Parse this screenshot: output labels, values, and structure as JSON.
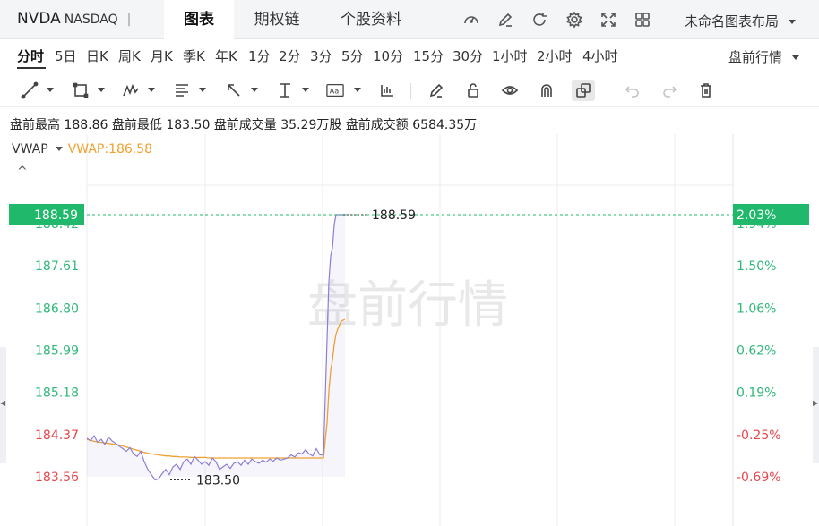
{
  "header": {
    "ticker": "NVDA",
    "exchange": "NASDAQ",
    "separator": "|",
    "tabs": [
      {
        "label": "图表",
        "active": true
      },
      {
        "label": "期权链",
        "active": false
      },
      {
        "label": "个股资料",
        "active": false
      }
    ],
    "icons": [
      "gauge-icon",
      "edit-icon",
      "refresh-icon",
      "gear-icon",
      "fullscreen-icon",
      "grid-icon"
    ],
    "layout_name": "未命名图表布局"
  },
  "periods": {
    "items": [
      "分时",
      "5日",
      "日K",
      "周K",
      "月K",
      "季K",
      "年K",
      "1分",
      "2分",
      "3分",
      "5分",
      "10分",
      "15分",
      "30分",
      "1小时",
      "2小时",
      "4小时"
    ],
    "active": "分时",
    "session": "盘前行情"
  },
  "toolbar": {
    "tools": [
      "line-tool-icon",
      "rect-tool-icon",
      "wave-tool-icon",
      "fib-tool-icon",
      "arrow-tool-icon",
      "measure-tool-icon",
      "text-tool-icon",
      "bar-indicator-icon",
      "pen-icon",
      "lock-icon",
      "eye-icon",
      "magnet-icon",
      "link-icon",
      "undo-icon",
      "redo-icon",
      "trash-icon"
    ]
  },
  "stats": {
    "high_label": "盘前最高",
    "high": "188.86",
    "low_label": "盘前最低",
    "low": "183.50",
    "vol_label": "盘前成交量",
    "vol": "35.29万股",
    "amount_label": "盘前成交额",
    "amount": "6584.35万"
  },
  "indicator": {
    "name": "VWAP",
    "value_text": "VWAP:186.58",
    "collapse_glyph": "^"
  },
  "colors": {
    "up": "#2fb87a",
    "down": "#e5484d",
    "price_line": "#8b7fd6",
    "vwap_line": "#f0a030",
    "current_tag": "#20b86a",
    "watermark": "#e8e8e8"
  },
  "chart_data": {
    "type": "line",
    "watermark": "盘前行情",
    "y_left_labels": [
      "188.42",
      "187.61",
      "186.80",
      "185.99",
      "185.18",
      "184.37",
      "183.56"
    ],
    "y_left_values": [
      188.42,
      187.61,
      186.8,
      185.99,
      185.18,
      184.37,
      183.56
    ],
    "y_right_labels": [
      "1.94%",
      "1.50%",
      "1.06%",
      "0.62%",
      "0.19%",
      "-0.25%",
      "-0.69%"
    ],
    "ylim": [
      183.3,
      188.7
    ],
    "current_price": "188.59",
    "current_price_value": 188.59,
    "current_change": "2.03%",
    "high_marker": "188.59",
    "high_marker_value": 188.59,
    "low_marker": "183.50",
    "low_marker_value": 183.5,
    "x": [
      0,
      4,
      8,
      12,
      16,
      20,
      24,
      28,
      32,
      36,
      40,
      44,
      48,
      52,
      56,
      60,
      64,
      68,
      72,
      76,
      80,
      84,
      88,
      92,
      96,
      100,
      104,
      108,
      112,
      116,
      120,
      124,
      128,
      132,
      136,
      140,
      144,
      148,
      152,
      156,
      160,
      164,
      168,
      172,
      176,
      180,
      184,
      188,
      192,
      196,
      200,
      204,
      208,
      212,
      216,
      220,
      224,
      228,
      232,
      236,
      240,
      244,
      248,
      252,
      256,
      260,
      264,
      268,
      270,
      272,
      274,
      276,
      278,
      280,
      284,
      288
    ],
    "price": [
      184.3,
      184.25,
      184.35,
      184.22,
      184.28,
      184.18,
      184.32,
      184.25,
      184.2,
      184.15,
      184.1,
      184.05,
      184.12,
      184.0,
      183.95,
      184.05,
      183.85,
      183.7,
      183.6,
      183.5,
      183.52,
      183.62,
      183.7,
      183.6,
      183.75,
      183.8,
      183.7,
      183.85,
      183.9,
      183.8,
      183.95,
      183.88,
      183.8,
      183.85,
      183.78,
      183.92,
      183.85,
      183.7,
      183.75,
      183.8,
      183.72,
      183.82,
      183.85,
      183.78,
      183.88,
      183.8,
      183.9,
      183.85,
      183.82,
      183.88,
      183.84,
      183.9,
      183.86,
      183.92,
      183.88,
      183.9,
      183.92,
      183.98,
      183.94,
      184.02,
      184.0,
      184.08,
      184.0,
      183.96,
      184.1,
      183.98,
      183.98,
      186.2,
      187.3,
      187.8,
      187.95,
      188.4,
      188.59,
      188.59,
      188.59,
      188.59
    ],
    "vwap": [
      184.28,
      184.26,
      184.24,
      184.23,
      184.22,
      184.21,
      184.2,
      184.19,
      184.18,
      184.17,
      184.15,
      184.13,
      184.11,
      184.09,
      184.07,
      184.05,
      184.03,
      184.01,
      184.0,
      183.99,
      183.98,
      183.97,
      183.96,
      183.96,
      183.95,
      183.95,
      183.94,
      183.94,
      183.94,
      183.93,
      183.93,
      183.93,
      183.93,
      183.93,
      183.92,
      183.92,
      183.92,
      183.92,
      183.92,
      183.92,
      183.92,
      183.92,
      183.92,
      183.92,
      183.92,
      183.92,
      183.92,
      183.92,
      183.92,
      183.92,
      183.92,
      183.92,
      183.92,
      183.92,
      183.92,
      183.92,
      183.92,
      183.92,
      183.92,
      183.92,
      183.92,
      183.92,
      183.92,
      183.92,
      183.92,
      183.92,
      183.92,
      184.6,
      185.2,
      185.6,
      185.8,
      186.1,
      186.3,
      186.4,
      186.55,
      186.58
    ]
  }
}
